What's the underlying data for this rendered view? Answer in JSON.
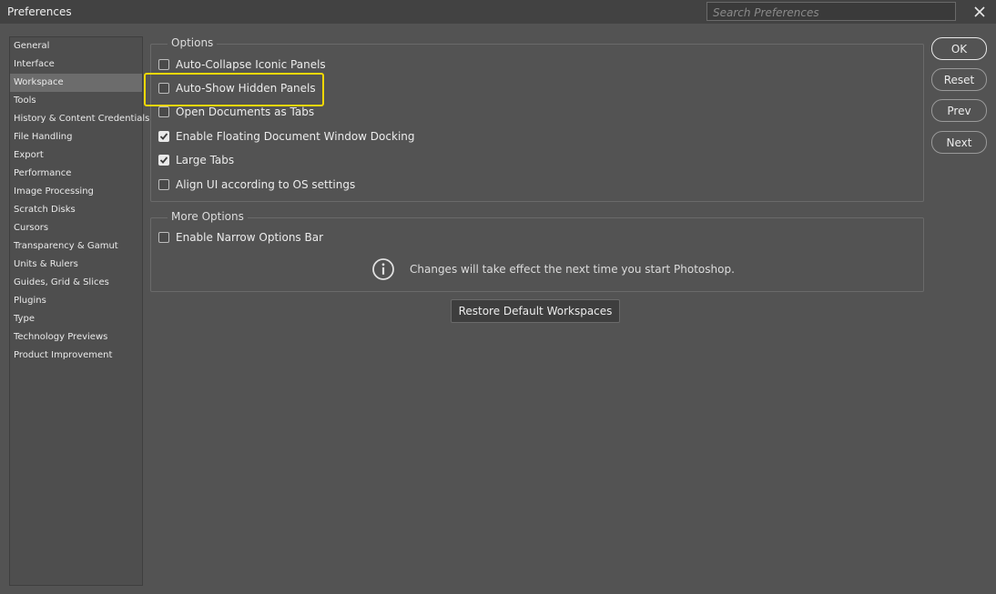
{
  "window": {
    "title": "Preferences",
    "search_placeholder": "Search Preferences"
  },
  "sidebar": {
    "items": [
      {
        "label": "General"
      },
      {
        "label": "Interface"
      },
      {
        "label": "Workspace",
        "active": true
      },
      {
        "label": "Tools"
      },
      {
        "label": "History & Content Credentials"
      },
      {
        "label": "File Handling"
      },
      {
        "label": "Export"
      },
      {
        "label": "Performance"
      },
      {
        "label": "Image Processing"
      },
      {
        "label": "Scratch Disks"
      },
      {
        "label": "Cursors"
      },
      {
        "label": "Transparency & Gamut"
      },
      {
        "label": "Units & Rulers"
      },
      {
        "label": "Guides, Grid & Slices"
      },
      {
        "label": "Plugins"
      },
      {
        "label": "Type"
      },
      {
        "label": "Technology Previews"
      },
      {
        "label": "Product Improvement"
      }
    ]
  },
  "options": {
    "legend": "Options",
    "items": [
      {
        "label": "Auto-Collapse Iconic Panels",
        "checked": false
      },
      {
        "label": "Auto-Show Hidden Panels",
        "checked": false
      },
      {
        "label": "Open Documents as Tabs",
        "checked": false
      },
      {
        "label": "Enable Floating Document Window Docking",
        "checked": true
      },
      {
        "label": "Large Tabs",
        "checked": true
      },
      {
        "label": "Align UI according to OS settings",
        "checked": false
      }
    ]
  },
  "more_options": {
    "legend": "More Options",
    "items": [
      {
        "label": "Enable Narrow Options Bar",
        "checked": false
      }
    ],
    "info": "Changes will take effect the next time you start Photoshop."
  },
  "restore_button": "Restore Default Workspaces",
  "buttons": {
    "ok": "OK",
    "reset": "Reset",
    "prev": "Prev",
    "next": "Next"
  },
  "colors": {
    "highlight": "#f3d800",
    "background": "#535353",
    "titlebar": "#424242"
  }
}
